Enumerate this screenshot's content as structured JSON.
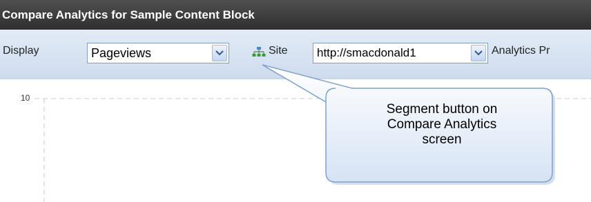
{
  "window": {
    "title": "Compare Analytics for Sample Content Block"
  },
  "toolbar": {
    "display_label": "Display",
    "display_value": "Pageviews",
    "site_label": "Site",
    "site_value": "http://smacdonald1",
    "analytics_label": "Analytics Pr"
  },
  "chart": {
    "y_tick_top": "10"
  },
  "callout": {
    "lines": [
      "Segment button on",
      "Compare Analytics",
      "screen"
    ]
  },
  "icons": {
    "segment": "sitemap-icon",
    "dropdown": "chevron-down-icon"
  }
}
